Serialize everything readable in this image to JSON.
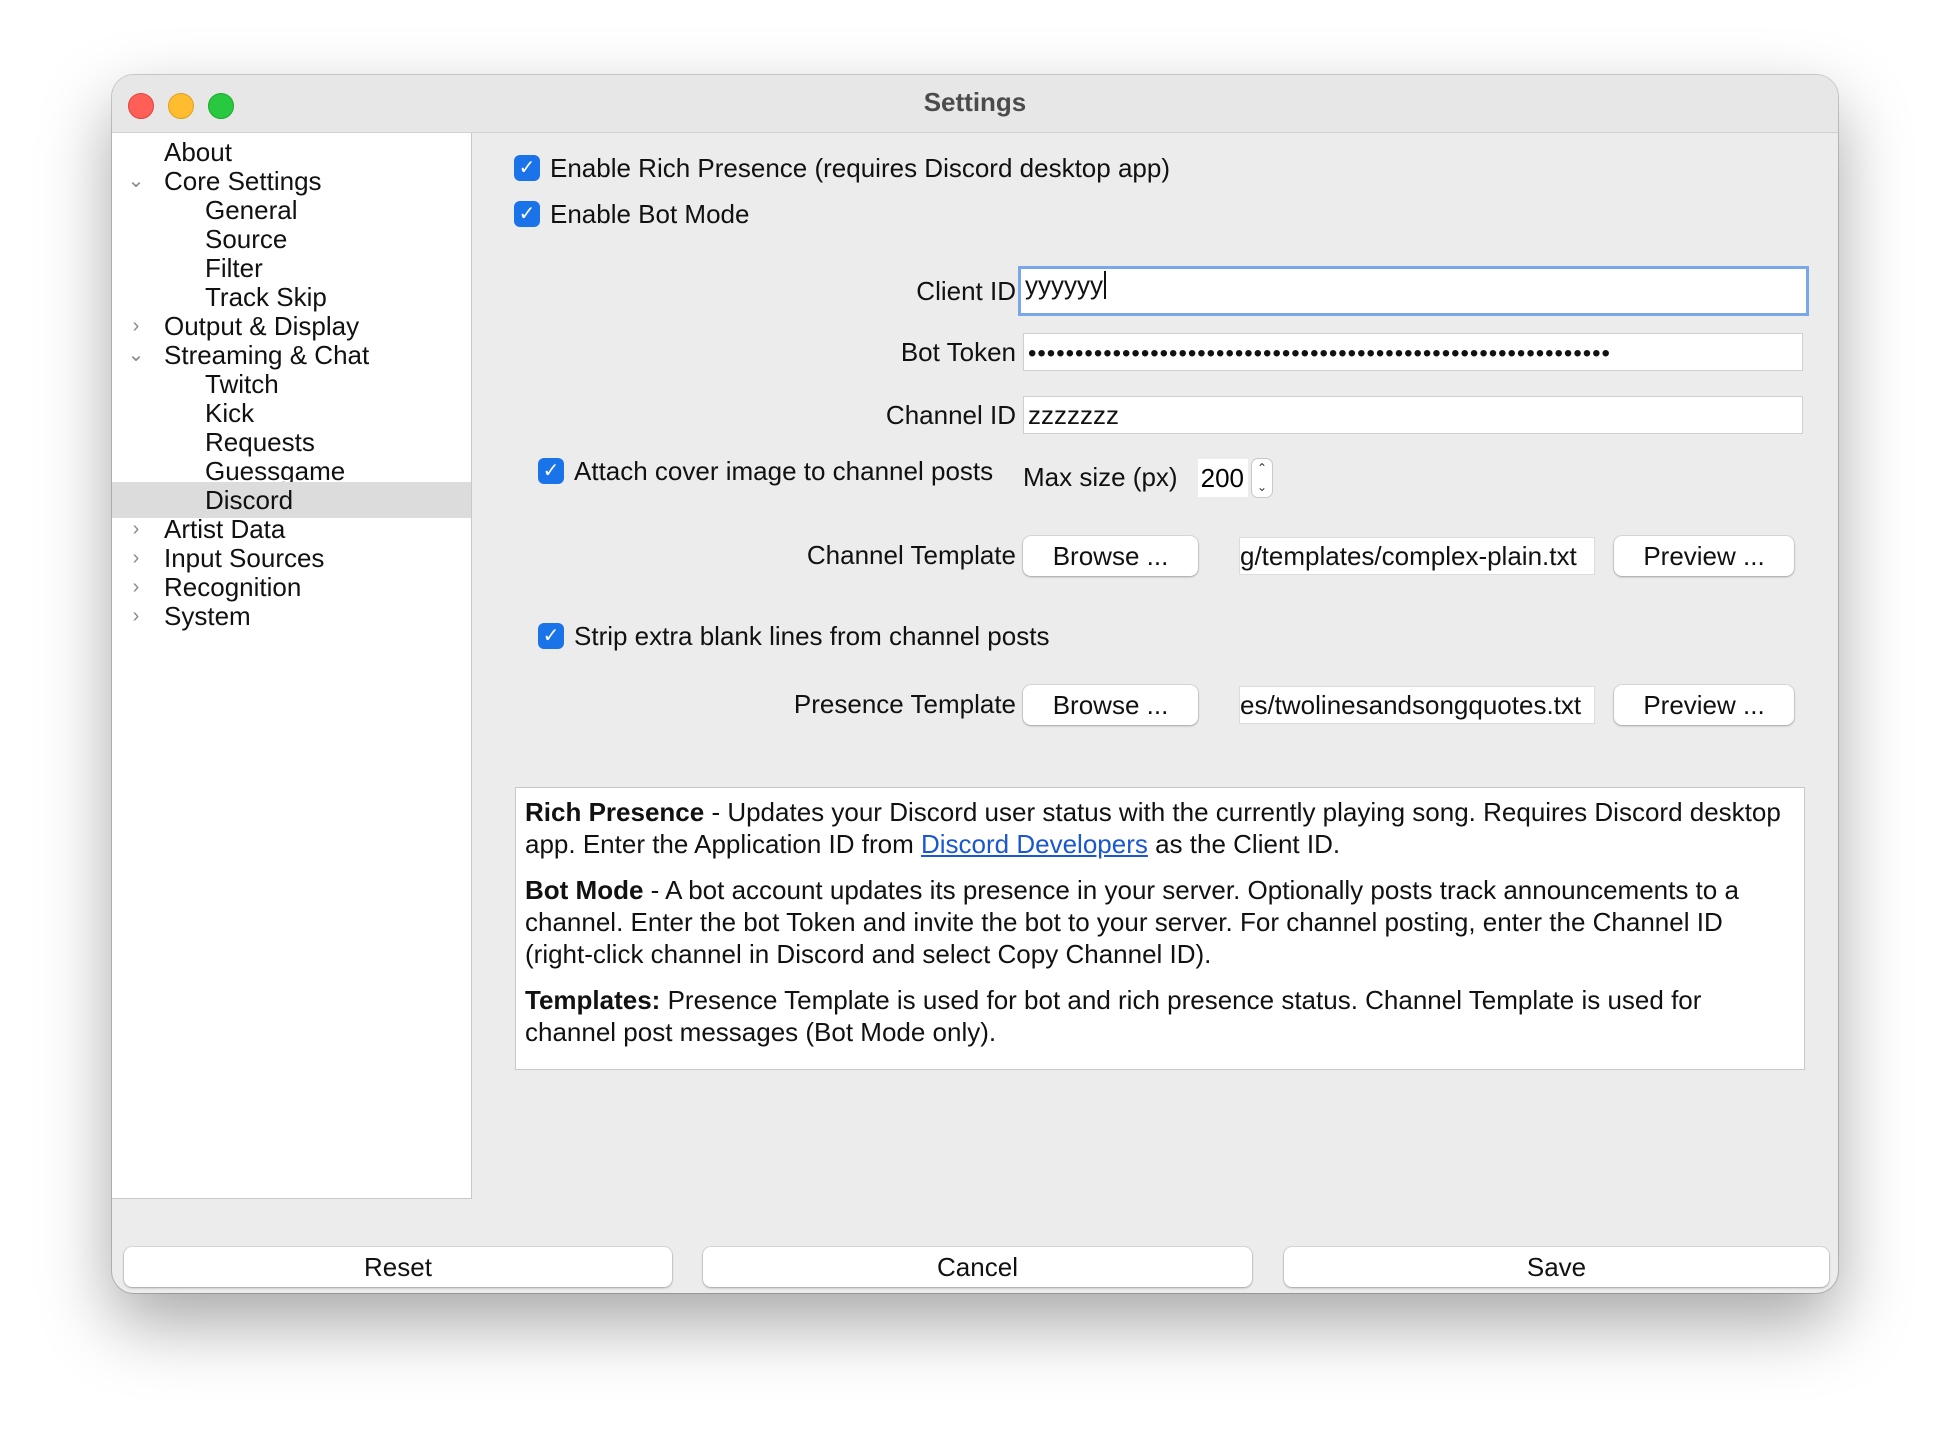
{
  "window": {
    "title": "Settings"
  },
  "sidebar": {
    "items": [
      {
        "label": "About",
        "level": 0,
        "arrow": ""
      },
      {
        "label": "Core Settings",
        "level": 0,
        "arrow": "expanded"
      },
      {
        "label": "General",
        "level": 1
      },
      {
        "label": "Source",
        "level": 1
      },
      {
        "label": "Filter",
        "level": 1
      },
      {
        "label": "Track Skip",
        "level": 1
      },
      {
        "label": "Output & Display",
        "level": 0,
        "arrow": "collapsed"
      },
      {
        "label": "Streaming & Chat",
        "level": 0,
        "arrow": "expanded"
      },
      {
        "label": "Twitch",
        "level": 1
      },
      {
        "label": "Kick",
        "level": 1
      },
      {
        "label": "Requests",
        "level": 1
      },
      {
        "label": "Guessgame",
        "level": 1
      },
      {
        "label": "Discord",
        "level": 1,
        "selected": true
      },
      {
        "label": "Artist Data",
        "level": 0,
        "arrow": "collapsed"
      },
      {
        "label": "Input Sources",
        "level": 0,
        "arrow": "collapsed"
      },
      {
        "label": "Recognition",
        "level": 0,
        "arrow": "collapsed"
      },
      {
        "label": "System",
        "level": 0,
        "arrow": "collapsed"
      }
    ]
  },
  "discord": {
    "enable_rich_presence": {
      "label": "Enable Rich Presence (requires Discord desktop app)",
      "checked": true
    },
    "enable_bot_mode": {
      "label": "Enable Bot Mode",
      "checked": true
    },
    "client_id": {
      "label": "Client ID",
      "value": "yyyyyy"
    },
    "bot_token": {
      "label": "Bot Token",
      "value": "••••••••••••••••••••••••••••••••••••••••••••••••••••••••••••••"
    },
    "channel_id": {
      "label": "Channel ID",
      "value": "zzzzzzz"
    },
    "attach_cover": {
      "label": "Attach cover image to channel posts",
      "checked": true
    },
    "max_size": {
      "label": "Max size (px)",
      "value": "200"
    },
    "channel_template": {
      "label": "Channel Template",
      "browse_label": "Browse ...",
      "path": "g/templates/complex-plain.txt",
      "preview_label": "Preview ..."
    },
    "strip_blank_lines": {
      "label": "Strip extra blank lines from channel posts",
      "checked": true
    },
    "presence_template": {
      "label": "Presence Template",
      "browse_label": "Browse ...",
      "path": "es/twolinesandsongquotes.txt",
      "preview_label": "Preview ..."
    }
  },
  "help": {
    "rich_presence_title": "Rich Presence",
    "rich_presence_text_1": " - Updates your Discord user status with the currently playing song. Requires Discord desktop app. Enter the Application ID from ",
    "rich_presence_link": "Discord Developers",
    "rich_presence_text_2": " as the Client ID.",
    "bot_mode_title": "Bot Mode",
    "bot_mode_text": " - A bot account updates its presence in your server. Optionally posts track announcements to a channel. Enter the bot Token and invite the bot to your server. For channel posting, enter the Channel ID (right-click channel in Discord and select Copy Channel ID).",
    "templates_title": "Templates:",
    "templates_text": " Presence Template is used for bot and rich presence status. Channel Template is used for channel post messages (Bot Mode only)."
  },
  "footer": {
    "reset_label": "Reset",
    "cancel_label": "Cancel",
    "save_label": "Save"
  },
  "colors": {
    "accent": "#1a73e8",
    "link": "#1a57d0",
    "selection": "#dcdcdc"
  }
}
